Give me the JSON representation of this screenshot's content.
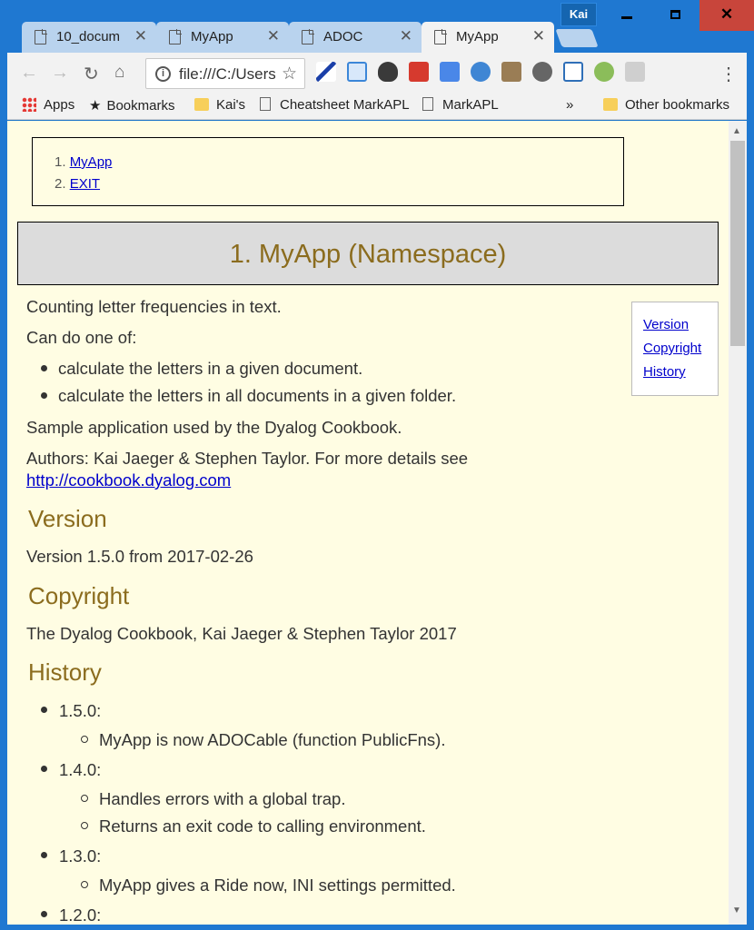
{
  "window": {
    "profile": "Kai",
    "min_glyph": "minimize",
    "max_glyph": "maximize",
    "close_glyph": "✕"
  },
  "tabs": [
    {
      "label": "10_docum",
      "close": "✕"
    },
    {
      "label": "MyApp",
      "close": "✕"
    },
    {
      "label": "ADOC",
      "close": "✕"
    },
    {
      "label": "MyApp",
      "close": "✕",
      "active": true
    }
  ],
  "toolbar": {
    "url": "file:///C:/Users/kai/AppData/Local/Temp",
    "info_icon": "i"
  },
  "bookmarks": {
    "apps": "Apps",
    "bookmarks": "Bookmarks",
    "kais": "Kai's",
    "cheatsheet": "Cheatsheet MarkAPL",
    "markapl": "MarkAPL",
    "overflow": "»",
    "other": "Other bookmarks"
  },
  "page": {
    "toc": [
      {
        "num": "1.",
        "label": "MyApp"
      },
      {
        "num": "2.",
        "label": "EXIT"
      }
    ],
    "title": "1. MyApp (Namespace)",
    "sidenav": [
      "Version",
      "Copyright",
      "History"
    ],
    "intro": "Counting letter frequencies in text.",
    "can_do": "Can do one of:",
    "options": [
      "calculate the letters in a given document.",
      "calculate the letters in all documents in a given folder."
    ],
    "sample": "Sample application used by the Dyalog Cookbook.",
    "authors": "Authors: Kai Jaeger & Stephen Taylor. For more details see",
    "link": "http://cookbook.dyalog.com",
    "version_heading": "Version",
    "version_text": "Version 1.5.0 from 2017-02-26",
    "copyright_heading": "Copyright",
    "copyright_text": "The Dyalog Cookbook, Kai Jaeger & Stephen Taylor 2017",
    "history_heading": "History",
    "history": [
      {
        "version": "1.5.0:",
        "notes": [
          "MyApp is now ADOCable (function PublicFns)."
        ]
      },
      {
        "version": "1.4.0:",
        "notes": [
          "Handles errors with a global trap.",
          "Returns an exit code to calling environment."
        ]
      },
      {
        "version": "1.3.0:",
        "notes": [
          "MyApp gives a Ride now, INI settings permitted."
        ]
      },
      {
        "version": "1.2.0:",
        "notes": []
      }
    ]
  }
}
